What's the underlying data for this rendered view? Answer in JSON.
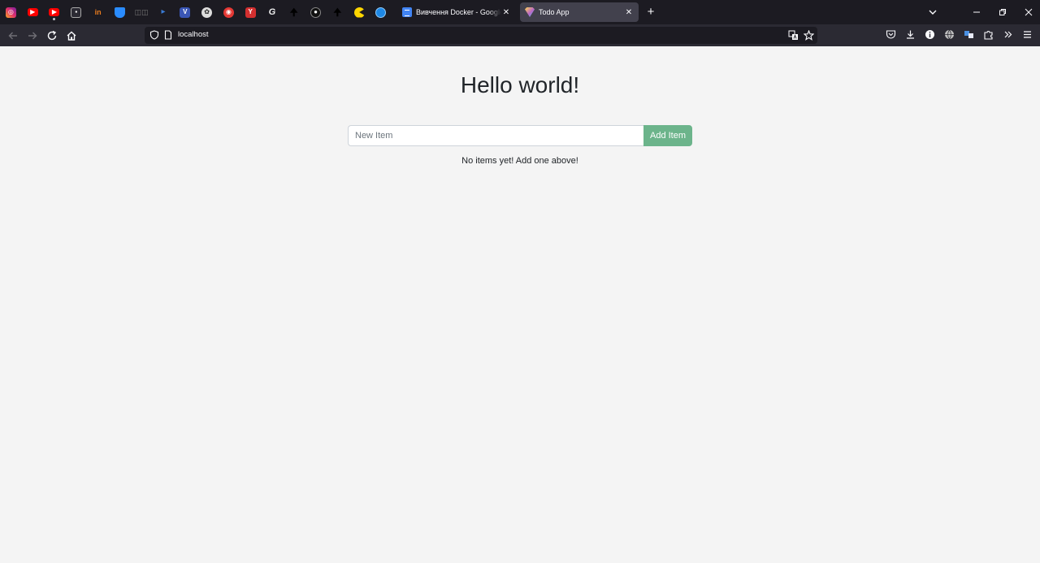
{
  "colors": {
    "tab_strip_bg": "#1c1b22",
    "nav_bg": "#2b2a33",
    "active_tab_bg": "#42414d",
    "page_bg": "#f4f4f4",
    "accent_green": "#6cb48b"
  },
  "browser": {
    "pinned_tabs": [
      {
        "icon": "instagram-icon",
        "color": "#e1306c"
      },
      {
        "icon": "youtube-icon",
        "color": "#ff0000"
      },
      {
        "icon": "youtube-icon",
        "color": "#ff0000"
      },
      {
        "icon": "image-icon",
        "color": "#888888"
      },
      {
        "icon": "in-icon",
        "color": "#e87b1e"
      },
      {
        "icon": "shield-icon",
        "color": "#2a8cff"
      },
      {
        "icon": "glasses-icon",
        "color": "#777777"
      },
      {
        "icon": "play-icon",
        "color": "#3a7bd5"
      },
      {
        "icon": "v-icon",
        "color": "#3a56b5"
      },
      {
        "icon": "chatgpt-icon",
        "color": "#dddddd"
      },
      {
        "icon": "camera-icon",
        "color": "#e53935"
      },
      {
        "icon": "y-icon",
        "color": "#d32f2f"
      },
      {
        "icon": "g-icon",
        "color": "#eeeeee"
      },
      {
        "icon": "upload-icon",
        "color": "#111111"
      },
      {
        "icon": "agent-icon",
        "color": "#111111"
      },
      {
        "icon": "upload-icon",
        "color": "#111111"
      },
      {
        "icon": "pacman-icon",
        "color": "#ffd600"
      },
      {
        "icon": "globe-icon",
        "color": "#1e88e5"
      }
    ],
    "tabs": [
      {
        "title": "Вивчення Docker - Google Док",
        "close": "✕"
      },
      {
        "title": "Todo App",
        "close": "✕"
      }
    ],
    "url": "localhost"
  },
  "page": {
    "heading": "Hello world!",
    "new_item_placeholder": "New Item",
    "add_button_label": "Add Item",
    "empty_message": "No items yet! Add one above!"
  }
}
